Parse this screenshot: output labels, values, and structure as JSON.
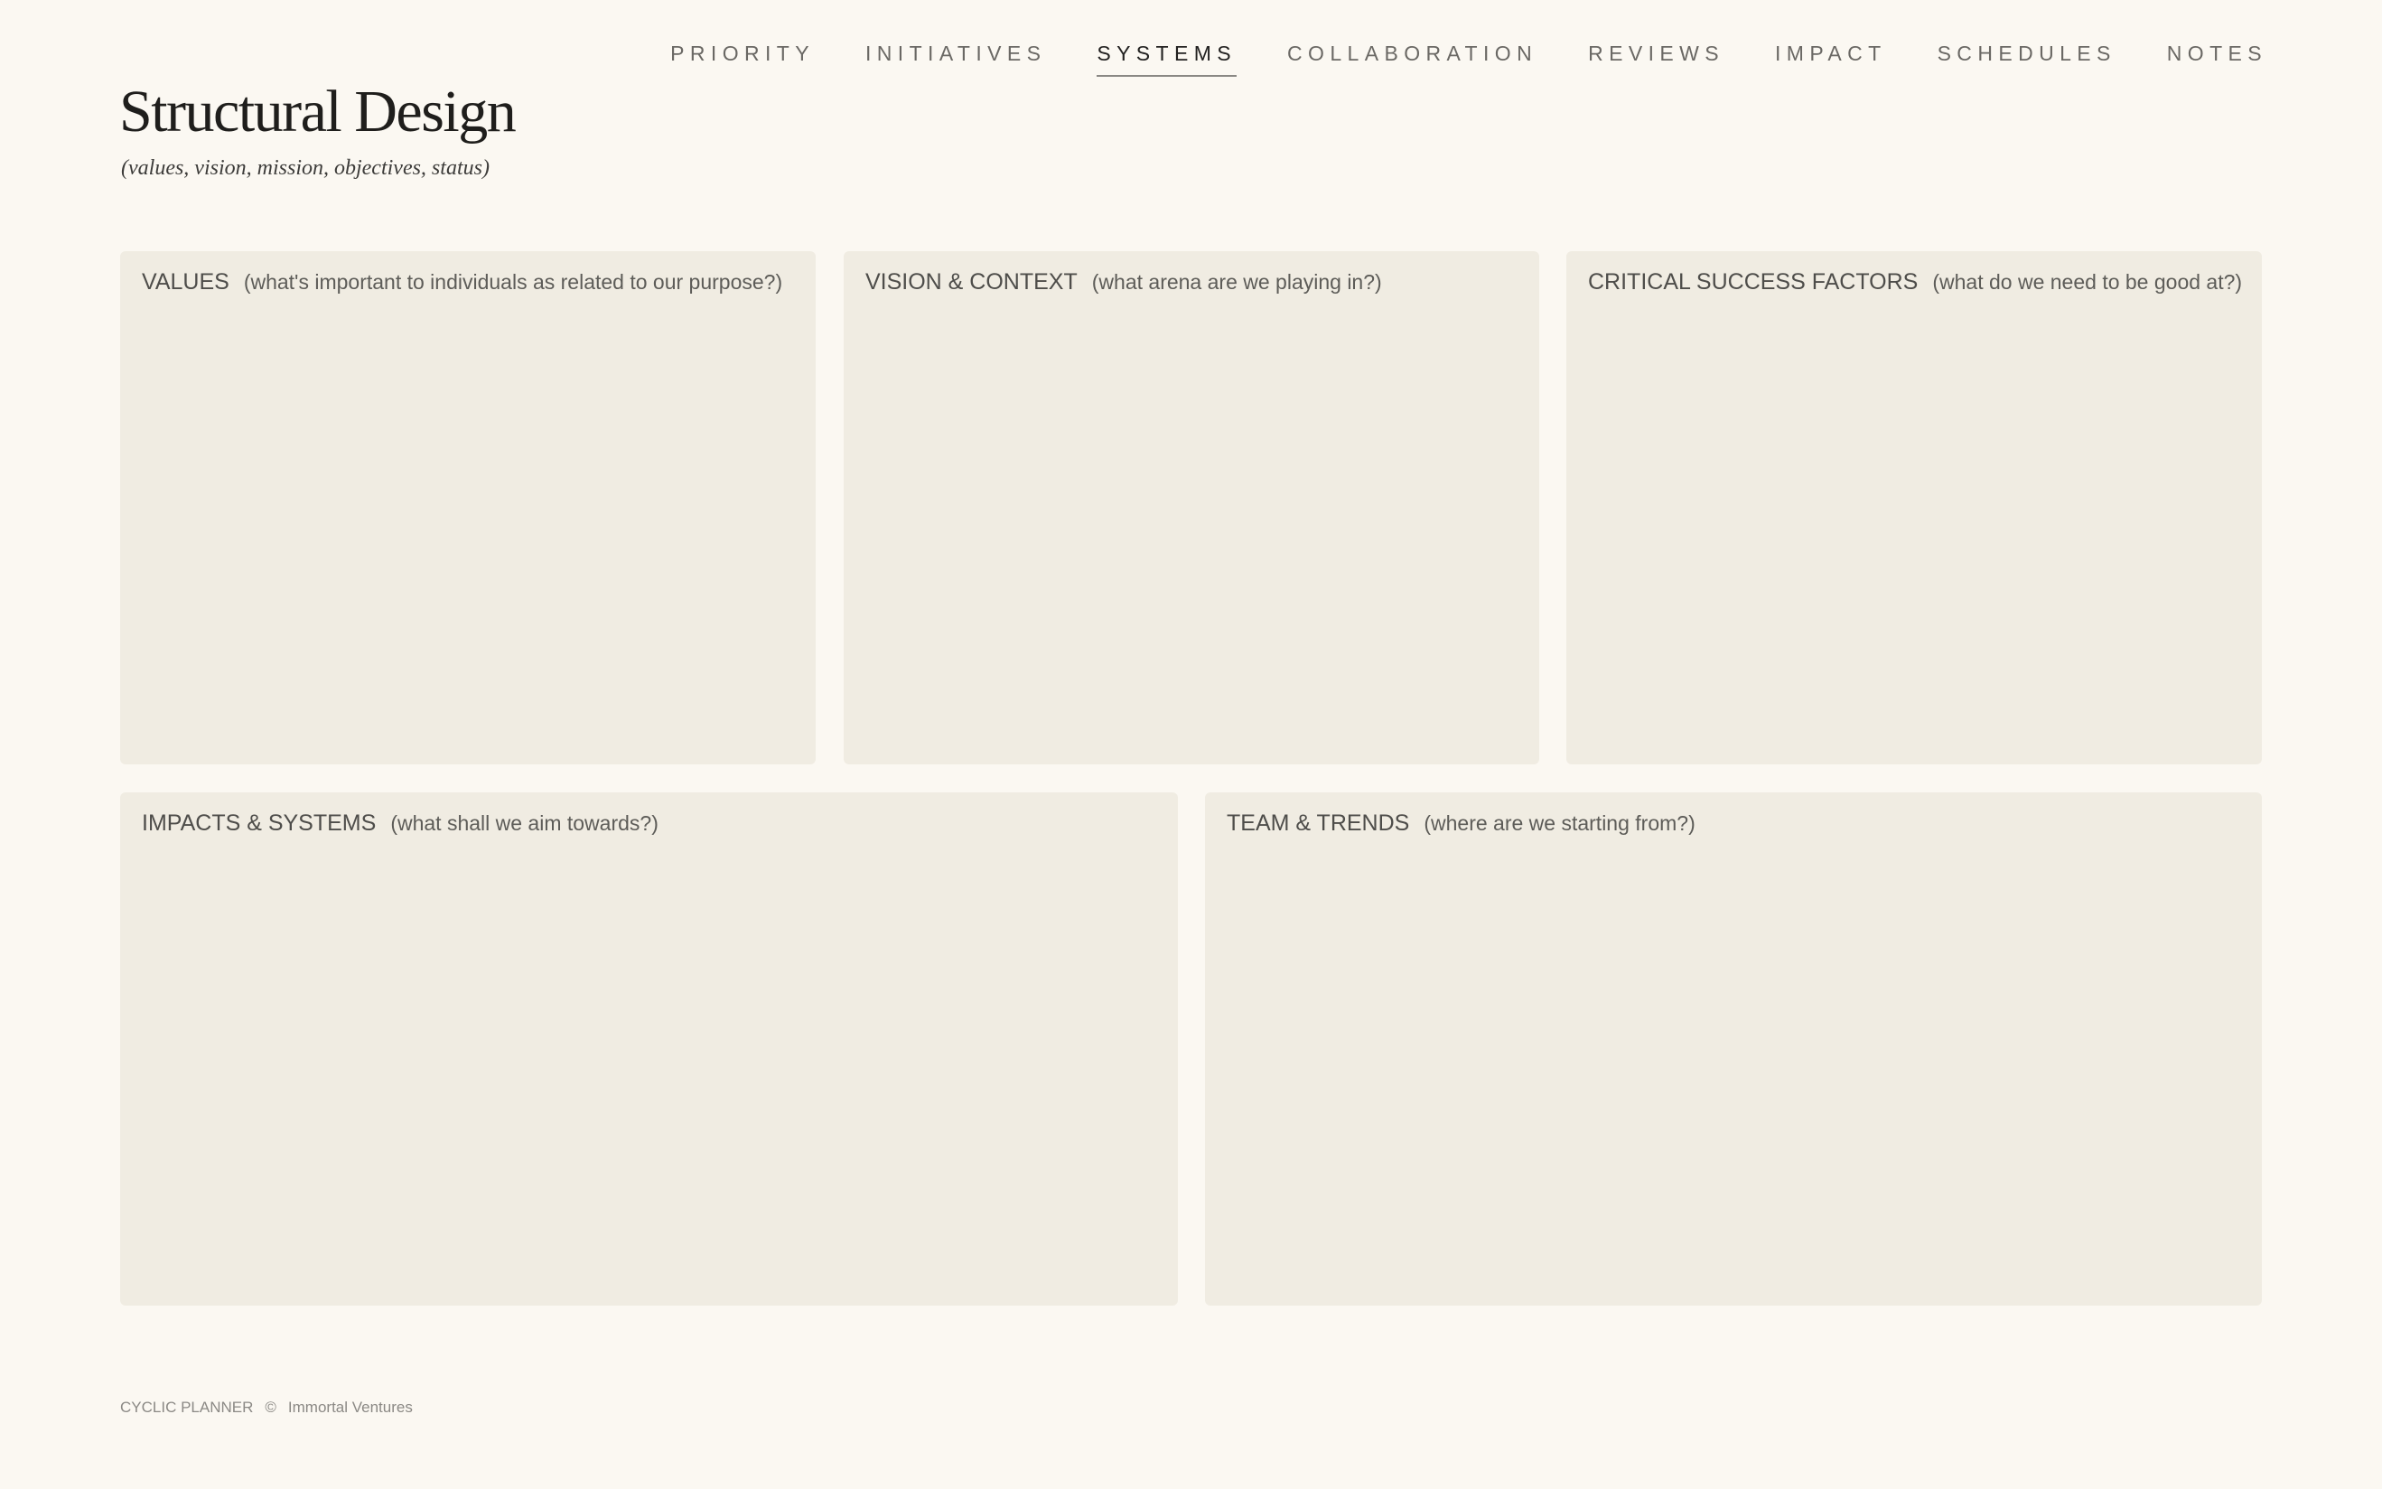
{
  "nav": {
    "items": [
      {
        "label": "PRIORITY"
      },
      {
        "label": "INITIATIVES"
      },
      {
        "label": "SYSTEMS"
      },
      {
        "label": "COLLABORATION"
      },
      {
        "label": "REVIEWS"
      },
      {
        "label": "IMPACT"
      },
      {
        "label": "SCHEDULES"
      },
      {
        "label": "NOTES"
      }
    ],
    "active": "SYSTEMS"
  },
  "page": {
    "title": "Structural Design",
    "subtitle": "(values, vision, mission, objectives, status)"
  },
  "panels": {
    "values": {
      "title": "VALUES",
      "hint": "(what's important to individuals as related to our purpose?)"
    },
    "vision": {
      "title": "VISION & CONTEXT",
      "hint": "(what arena are we playing in?)"
    },
    "csf": {
      "title": "CRITICAL SUCCESS FACTORS",
      "hint": "(what do we need to be good at?)"
    },
    "impacts": {
      "title": "IMPACTS & SYSTEMS",
      "hint": "(what shall we aim towards?)"
    },
    "team": {
      "title": "TEAM & TRENDS",
      "hint": "(where are we starting from?)"
    }
  },
  "footer": {
    "brand": "CYCLIC PLANNER",
    "copyright_symbol": "©",
    "company": "Immortal Ventures"
  },
  "colors": {
    "background": "#fbf8f2",
    "panel": "#f0ece2",
    "title_text": "#1f1e1c",
    "nav_text": "#6a6864",
    "nav_active": "#222120"
  }
}
